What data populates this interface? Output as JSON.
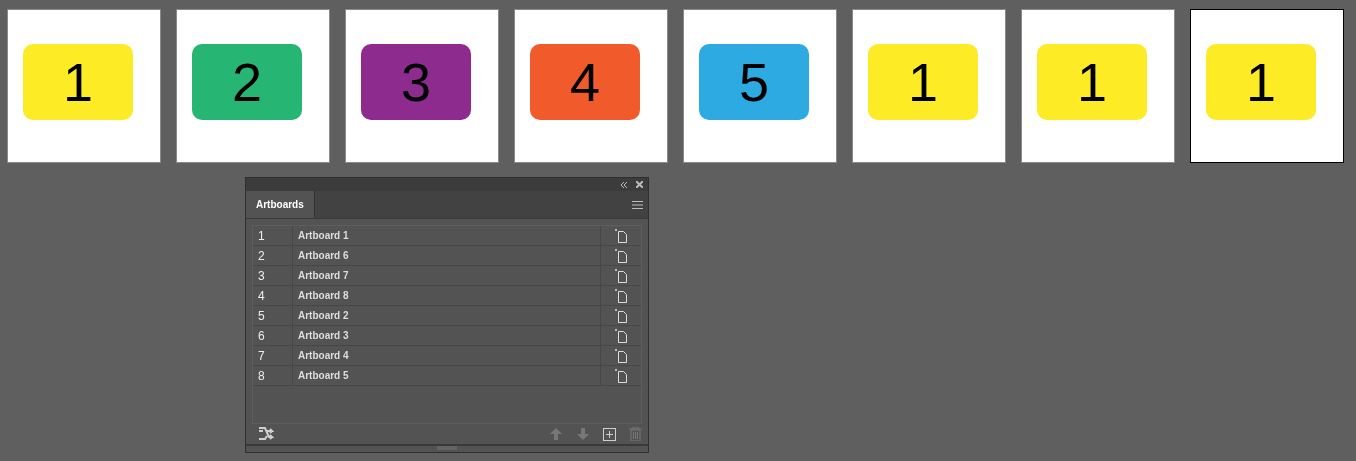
{
  "artboards": [
    {
      "label": "1",
      "color": "#fdeb26",
      "selected": false
    },
    {
      "label": "2",
      "color": "#27b574",
      "selected": false
    },
    {
      "label": "3",
      "color": "#8e2b8f",
      "selected": false
    },
    {
      "label": "4",
      "color": "#f15a2b",
      "selected": false
    },
    {
      "label": "5",
      "color": "#2eaae2",
      "selected": false
    },
    {
      "label": "1",
      "color": "#fdeb26",
      "selected": false
    },
    {
      "label": "1",
      "color": "#fdeb26",
      "selected": false
    },
    {
      "label": "1",
      "color": "#fdeb26",
      "selected": true
    }
  ],
  "panel": {
    "tab": "Artboards",
    "rows": [
      {
        "number": "1",
        "name": "Artboard 1"
      },
      {
        "number": "2",
        "name": "Artboard 6"
      },
      {
        "number": "3",
        "name": "Artboard 7"
      },
      {
        "number": "4",
        "name": "Artboard 8"
      },
      {
        "number": "5",
        "name": "Artboard 2"
      },
      {
        "number": "6",
        "name": "Artboard 3"
      },
      {
        "number": "7",
        "name": "Artboard 4"
      },
      {
        "number": "8",
        "name": "Artboard 5"
      }
    ],
    "footer_buttons": [
      {
        "kind": "rearrange",
        "disabled": false
      },
      {
        "kind": "move-up",
        "disabled": true
      },
      {
        "kind": "move-down",
        "disabled": true
      },
      {
        "kind": "new",
        "disabled": false
      },
      {
        "kind": "delete",
        "disabled": true
      }
    ]
  }
}
